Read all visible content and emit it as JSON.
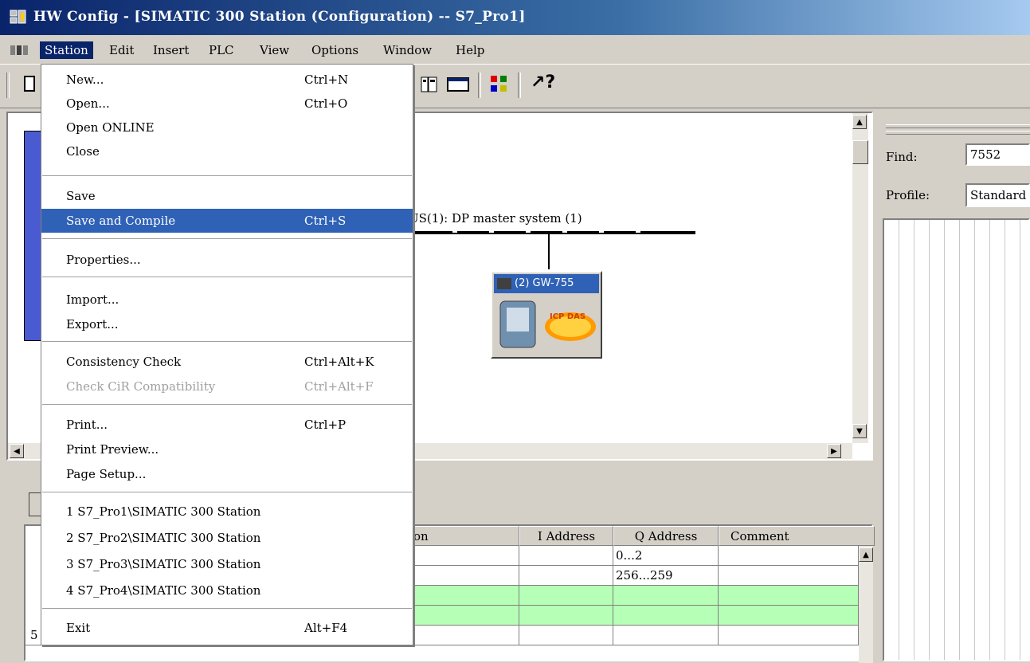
{
  "window": {
    "title": "HW Config - [SIMATIC 300 Station (Configuration) -- S7_Pro1]"
  },
  "menubar": {
    "items": [
      {
        "label": "Station"
      },
      {
        "label": "Edit"
      },
      {
        "label": "Insert"
      },
      {
        "label": "PLC"
      },
      {
        "label": "View"
      },
      {
        "label": "Options"
      },
      {
        "label": "Window"
      },
      {
        "label": "Help"
      }
    ]
  },
  "station_menu": {
    "items": [
      {
        "label": "New...",
        "shortcut": "Ctrl+N"
      },
      {
        "label": "Open...",
        "shortcut": "Ctrl+O"
      },
      {
        "label": "Open ONLINE",
        "shortcut": ""
      },
      {
        "label": "Close",
        "shortcut": ""
      },
      {
        "label": "Save",
        "shortcut": ""
      },
      {
        "label": "Save and Compile",
        "shortcut": "Ctrl+S",
        "highlighted": true
      },
      {
        "label": "Properties...",
        "shortcut": ""
      },
      {
        "label": "Import...",
        "shortcut": ""
      },
      {
        "label": "Export...",
        "shortcut": ""
      },
      {
        "label": "Consistency Check",
        "shortcut": "Ctrl+Alt+K"
      },
      {
        "label": "Check CiR Compatibility",
        "shortcut": "Ctrl+Alt+F",
        "disabled": true
      },
      {
        "label": "Print...",
        "shortcut": "Ctrl+P"
      },
      {
        "label": "Print Preview...",
        "shortcut": ""
      },
      {
        "label": "Page Setup...",
        "shortcut": ""
      },
      {
        "label": "1 S7_Pro1\\SIMATIC 300 Station",
        "shortcut": ""
      },
      {
        "label": "2 S7_Pro2\\SIMATIC 300 Station",
        "shortcut": ""
      },
      {
        "label": "3 S7_Pro3\\SIMATIC 300 Station",
        "shortcut": ""
      },
      {
        "label": "4 S7_Pro4\\SIMATIC 300 Station",
        "shortcut": ""
      },
      {
        "label": "Exit",
        "shortcut": "Alt+F4"
      }
    ]
  },
  "network": {
    "dp_label": "US(1): DP master system (1)",
    "slave_title": "(2) GW-755",
    "slave_logo": "ICP DAS"
  },
  "catalog": {
    "find_label": "Find:",
    "find_value": "7552",
    "profile_label": "Profile:",
    "profile_value": "Standard"
  },
  "table": {
    "headers": [
      "on",
      "I Address",
      "Q Address",
      "Comment"
    ],
    "rows": [
      {
        "i": "",
        "q": "0...2",
        "comment": ""
      },
      {
        "i": "",
        "q": "256...259",
        "comment": ""
      },
      {
        "i": "",
        "q": "",
        "comment": ""
      },
      {
        "i": "",
        "q": "",
        "comment": ""
      },
      {
        "i": "",
        "q": "",
        "comment": ""
      }
    ],
    "last_row_number": "5"
  },
  "colors": {
    "title_gradient_start": "#0a246a",
    "menu_highlight": "#2f62b6",
    "table_green": "#b6ffb6"
  }
}
